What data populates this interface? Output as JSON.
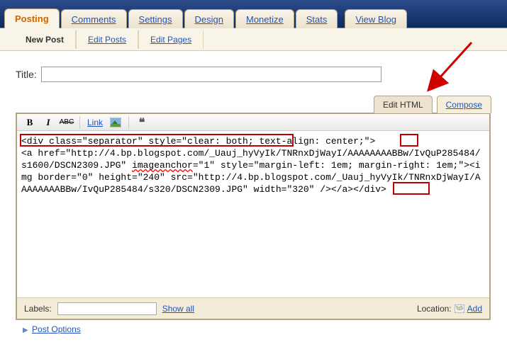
{
  "tabs": {
    "posting": "Posting",
    "comments": "Comments",
    "settings": "Settings",
    "design": "Design",
    "monetize": "Monetize",
    "stats": "Stats",
    "viewblog": "View Blog"
  },
  "subtabs": {
    "newpost": "New Post",
    "editposts": "Edit Posts",
    "editpages": "Edit Pages"
  },
  "title_label": "Title:",
  "title_value": "",
  "mode": {
    "edithtml": "Edit HTML",
    "compose": "Compose"
  },
  "toolbar": {
    "bold": "B",
    "italic": "I",
    "strike": "ABC",
    "link": "Link",
    "quote": "❝"
  },
  "code": {
    "l1a": "<div class=\"separator\" style=\"clear: both;",
    "l1b": " text-align: center;\"",
    "l1c": ">",
    "l2": "<a href=\"http://4.bp.blogspot.com/_Uauj_hyVyIk/TNRnxDjWayI/AAAAAAAABBw/IvQuP285484/s1600/DSCN2309.JPG\" ",
    "l2_typo": "imageanchor",
    "l2b": "=\"1\" style=\"margin-left: 1em; margin-right: 1em;\"><img border=\"0\" height=\"240\" src=\"http://4.bp.blogspot.com/_Uauj_hyVyIk/TNRnxDjWayI/AAAAAAAABBw/IvQuP285484/s320/DSCN2309.JPG\" width=\"320\" /></a>",
    "l2_end": "</div>"
  },
  "labels": {
    "label": "Labels:",
    "value": "",
    "showall": "Show all",
    "location": "Location:",
    "add": "Add"
  },
  "post_options": "Post Options"
}
